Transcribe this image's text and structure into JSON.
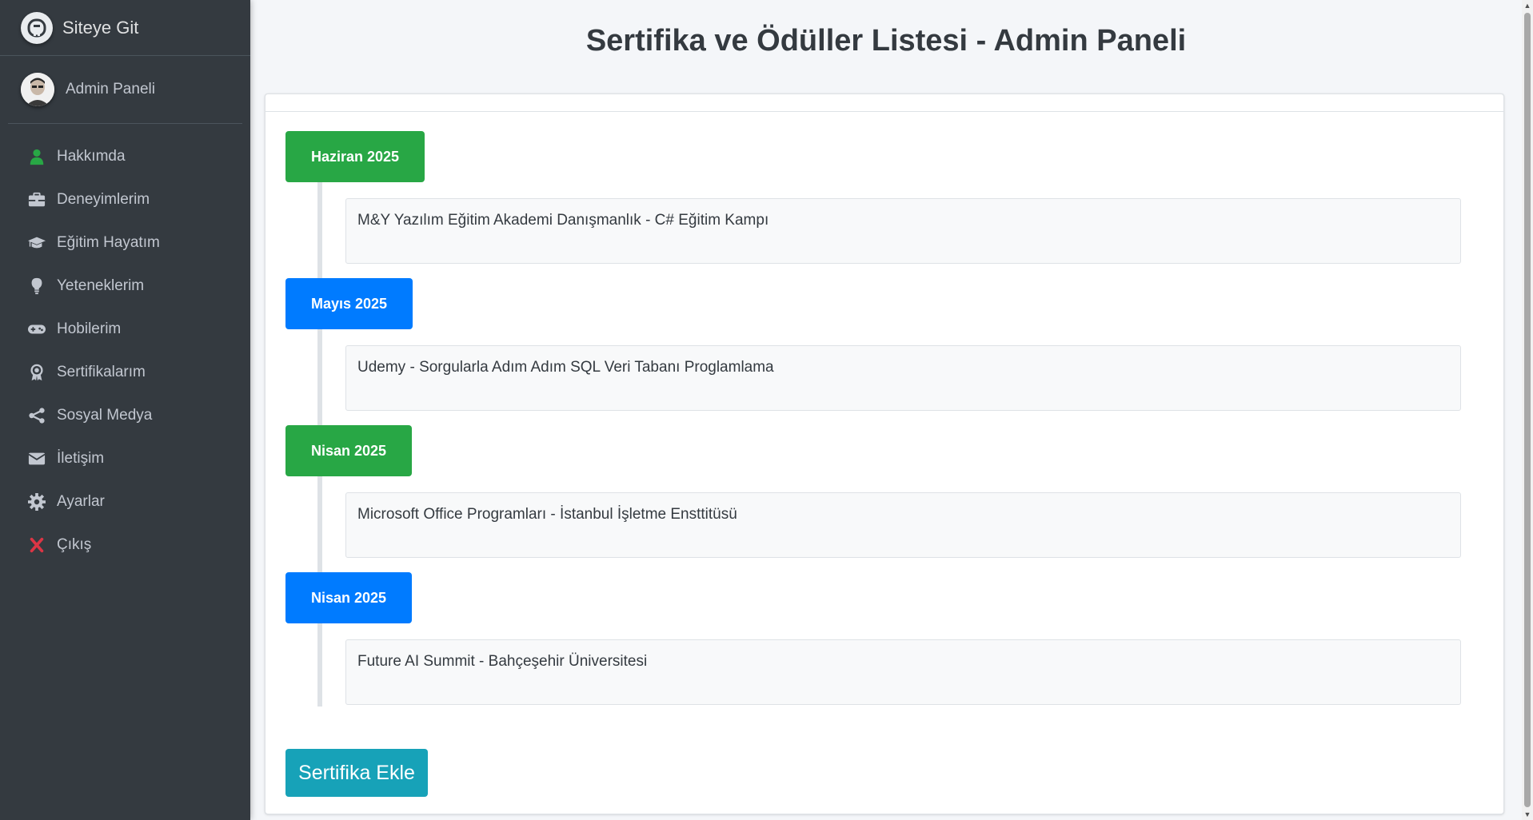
{
  "sidebar": {
    "brand": "Siteye Git",
    "user": "Admin Paneli",
    "items": [
      {
        "label": "Hakkımda",
        "icon": "user-icon",
        "color": "#28a745"
      },
      {
        "label": "Deneyimlerim",
        "icon": "briefcase-icon",
        "color": "#c2c7d0"
      },
      {
        "label": "Eğitim Hayatım",
        "icon": "graduation-cap-icon",
        "color": "#c2c7d0"
      },
      {
        "label": "Yeteneklerim",
        "icon": "lightbulb-icon",
        "color": "#c2c7d0"
      },
      {
        "label": "Hobilerim",
        "icon": "gamepad-icon",
        "color": "#c2c7d0"
      },
      {
        "label": "Sertifikalarım",
        "icon": "award-icon",
        "color": "#c2c7d0"
      },
      {
        "label": "Sosyal Medya",
        "icon": "share-icon",
        "color": "#c2c7d0"
      },
      {
        "label": "İletişim",
        "icon": "envelope-icon",
        "color": "#c2c7d0"
      },
      {
        "label": "Ayarlar",
        "icon": "gear-icon",
        "color": "#c2c7d0"
      },
      {
        "label": "Çıkış",
        "icon": "close-icon",
        "color": "#dc3545"
      }
    ]
  },
  "main": {
    "title": "Sertifika ve Ödüller Listesi - Admin Paneli",
    "timeline": [
      {
        "date": "Haziran 2025",
        "color": "#28a745",
        "text": "M&Y Yazılım Eğitim Akademi Danışmanlık - C# Eğitim Kampı"
      },
      {
        "date": "Mayıs 2025",
        "color": "#007bff",
        "text": "Udemy - Sorgularla Adım Adım SQL Veri Tabanı Proglamlama"
      },
      {
        "date": "Nisan 2025",
        "color": "#28a745",
        "text": "Microsoft Office Programları - İstanbul İşletme Ensttitüsü"
      },
      {
        "date": "Nisan 2025",
        "color": "#007bff",
        "text": "Future AI Summit - Bahçeşehir Üniversitesi"
      }
    ],
    "add_button": "Sertifika Ekle"
  }
}
